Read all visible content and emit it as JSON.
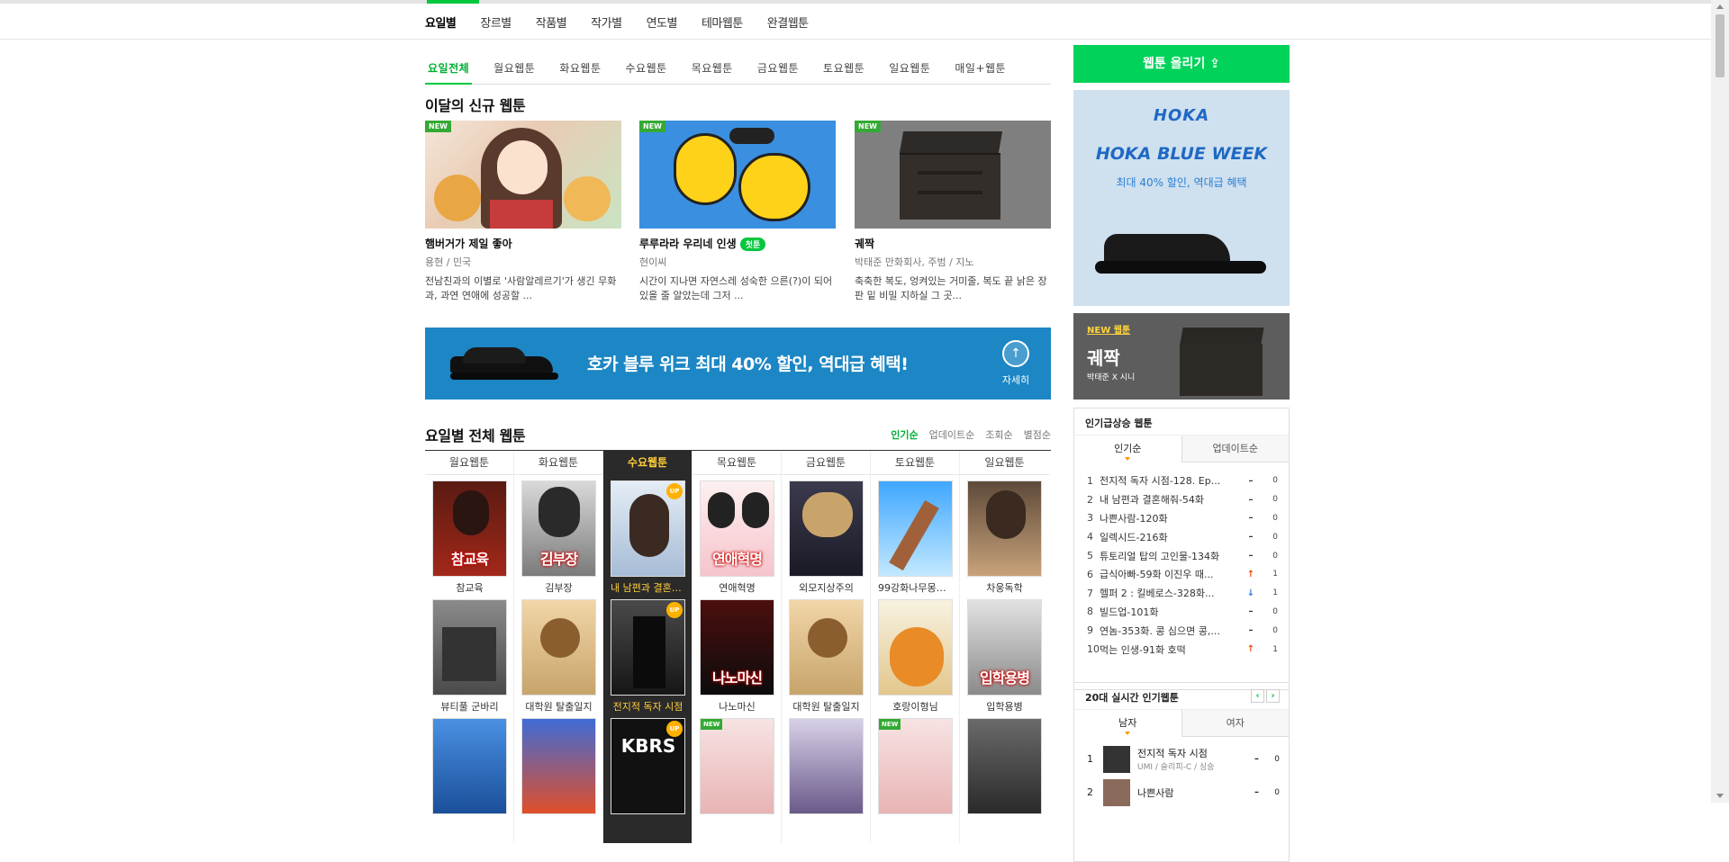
{
  "topnav": {
    "tabs": [
      "요일별",
      "장르별",
      "작품별",
      "작가별",
      "연도별",
      "테마웹툰",
      "완결웹툰"
    ]
  },
  "daytabs": [
    "요일전체",
    "월요웹툰",
    "화요웹툰",
    "수요웹툰",
    "목요웹툰",
    "금요웹툰",
    "토요웹툰",
    "일요웹툰",
    "매일+웹툰"
  ],
  "new_section": {
    "title": "이달의 신규 웹툰",
    "badge": "NEW",
    "items": [
      {
        "title": "햄버거가 제일 좋아",
        "author": "용현 / 민국",
        "desc": "전남친과의 이별로 '사람알레르기'가 생긴 무화과, 과연 연애에 성공할 ...",
        "first": ""
      },
      {
        "title": "루루라라 우리네 인생",
        "author": "현이씨",
        "desc": "시간이 지나면 자연스레 성숙한 으른(?)이 되어 있을 줄 알았는데 그저 ...",
        "first": "첫툰"
      },
      {
        "title": "궤짝",
        "author": "박태준 만화회사, 주범 / 지노",
        "desc": "축축한 복도, 엉켜있는 거미줄, 복도 끝 낡은 장판 밑 비밀 지하실 그 곳...",
        "first": ""
      }
    ]
  },
  "banner": {
    "text": "호카 블루 위크 최대 40% 할인, 역대급 혜택!",
    "more": "자세히",
    "arrow": "arrow-up-icon"
  },
  "day_section": {
    "title": "요일별 전체 웹툰",
    "sorts": [
      "인기순",
      "업데이트순",
      "조회순",
      "별점순"
    ],
    "up": "UP",
    "new": "NEW",
    "columns": [
      {
        "day": "월요웹툰",
        "comics": [
          "참교육",
          "뷰티풀 군바리",
          ""
        ]
      },
      {
        "day": "화요웹툰",
        "comics": [
          "김부장",
          "대학원 탈출일지",
          ""
        ]
      },
      {
        "day": "수요웹툰",
        "comics": [
          "내 남편과 결혼해줘",
          "전지적 독자 시점",
          ""
        ]
      },
      {
        "day": "목요웹툰",
        "comics": [
          "연애혁명",
          "나노마신",
          ""
        ]
      },
      {
        "day": "금요웹툰",
        "comics": [
          "외모지상주의",
          "대학원 탈출일지",
          ""
        ]
      },
      {
        "day": "토요웹툰",
        "comics": [
          "99강화나무몽둥이",
          "호랑이형님",
          ""
        ]
      },
      {
        "day": "일요웹툰",
        "comics": [
          "차웅독학",
          "입학용병",
          ""
        ]
      }
    ],
    "overlays": [
      "참교육",
      "김부장",
      "연애혁명",
      "나노마신",
      "입학용병",
      "KBRS"
    ]
  },
  "sidebar": {
    "upload": "웹툰 올리기",
    "ad": {
      "brand": "HOKA",
      "headline": "HOKA BLUE WEEK",
      "sub": "최대 40% 할인, 역대급 혜택"
    },
    "newweb": {
      "tag": "NEW 웹툰",
      "title": "궤짝",
      "author": "박태준 X 시니"
    },
    "rising": {
      "title": "인기급상승 웹툰",
      "tabs": [
        "인기순",
        "업데이트순"
      ],
      "rows": [
        {
          "n": "1",
          "t": "전지적 독자 시점-128. Ep...",
          "c": "–",
          "dir": "same",
          "v": "0"
        },
        {
          "n": "2",
          "t": "내 남편과 결혼해줘-54화",
          "c": "–",
          "dir": "same",
          "v": "0"
        },
        {
          "n": "3",
          "t": "나쁜사람-120화",
          "c": "–",
          "dir": "same",
          "v": "0"
        },
        {
          "n": "4",
          "t": "일렉시드-216화",
          "c": "–",
          "dir": "same",
          "v": "0"
        },
        {
          "n": "5",
          "t": "튜토리얼 탑의 고인물-134화",
          "c": "–",
          "dir": "same",
          "v": "0"
        },
        {
          "n": "6",
          "t": "급식아빠-59화 이진우 때...",
          "c": "↑",
          "dir": "up",
          "v": "1"
        },
        {
          "n": "7",
          "t": "헬퍼 2 : 킬베로스-328화...",
          "c": "↓",
          "dir": "down",
          "v": "1"
        },
        {
          "n": "8",
          "t": "빌드업-101화",
          "c": "–",
          "dir": "same",
          "v": "0"
        },
        {
          "n": "9",
          "t": "연놈-353화. 콩 심으면 콩,...",
          "c": "–",
          "dir": "same",
          "v": "0"
        },
        {
          "n": "10",
          "t": "먹는 인생-91화 호떡",
          "c": "↑",
          "dir": "up",
          "v": "1"
        }
      ]
    },
    "realtime": {
      "title": "20대 실시간 인기웹툰",
      "prev": "‹",
      "next": "›",
      "tabs": [
        "남자",
        "여자"
      ],
      "items": [
        {
          "n": "1",
          "t": "전지적 독자 시점",
          "a": "UMI / 슬리피-C / 싱숑",
          "c": "–",
          "v": "0"
        },
        {
          "n": "2",
          "t": "나쁜사람",
          "a": "",
          "c": "–",
          "v": "0"
        }
      ]
    }
  },
  "colors": {
    "accent": "#00c73c",
    "highlight_col": "#2a2a2a",
    "highlight_text": "#ffce3c",
    "banner": "#1d86c4"
  }
}
